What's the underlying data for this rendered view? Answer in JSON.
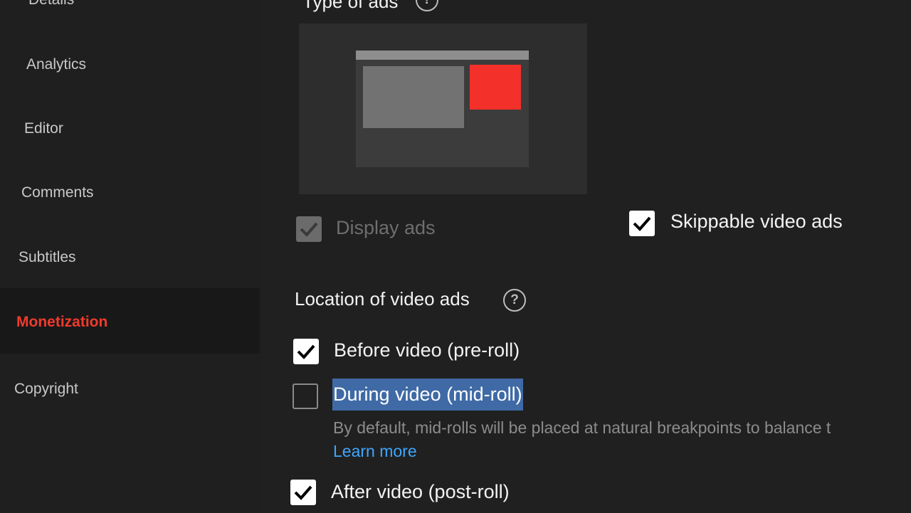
{
  "sidebar": {
    "items": [
      {
        "label": "Details"
      },
      {
        "label": "Analytics"
      },
      {
        "label": "Editor"
      },
      {
        "label": "Comments"
      },
      {
        "label": "Subtitles"
      },
      {
        "label": "Monetization",
        "active": true
      },
      {
        "label": "Copyright"
      }
    ],
    "active_color": "#ef3b2d"
  },
  "main": {
    "type_of_ads": {
      "title": "Type of ads",
      "help_icon": "help-circle-icon",
      "options": [
        {
          "label": "Display ads",
          "checked": true,
          "disabled": true
        },
        {
          "label": "Skippable video ads",
          "checked": true,
          "disabled": false
        }
      ]
    },
    "location": {
      "title": "Location of video ads",
      "help_icon": "help-circle-icon",
      "options": [
        {
          "label": "Before video (pre-roll)",
          "checked": true
        },
        {
          "label": "During video (mid-roll)",
          "checked": false,
          "text_selected": true
        },
        {
          "label": "After video (post-roll)",
          "checked": true
        }
      ],
      "midroll_help": "By default, mid-rolls will be placed at natural breakpoints to balance t",
      "learn_more": "Learn more"
    }
  },
  "colors": {
    "background": "#202020",
    "ad_highlight": "#f3302a",
    "link": "#3ea6ff",
    "selection": "#3f6aa6"
  }
}
